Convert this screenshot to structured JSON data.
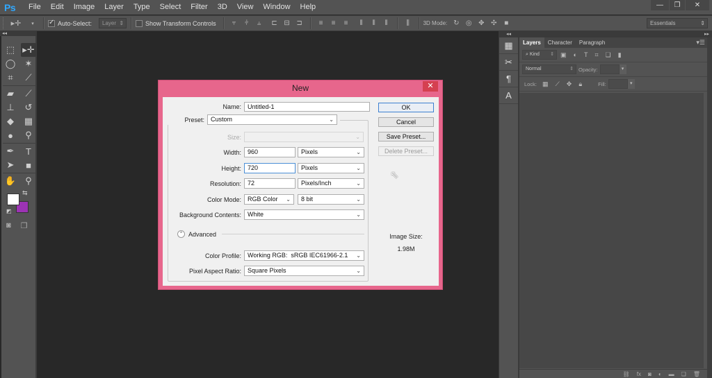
{
  "app": {
    "logo": "Ps",
    "menu": [
      "File",
      "Edit",
      "Image",
      "Layer",
      "Type",
      "Select",
      "Filter",
      "3D",
      "View",
      "Window",
      "Help"
    ],
    "window_controls": {
      "minimize": "—",
      "restore": "❐",
      "close": "✕"
    }
  },
  "options_bar": {
    "auto_select_label": "Auto-Select:",
    "auto_select_checked": true,
    "auto_select_target": "Layer",
    "show_transform_label": "Show Transform Controls",
    "show_transform_checked": false,
    "mode_3d_label": "3D Mode:",
    "workspace": "Essentials"
  },
  "toolbar": {
    "foreground_color": "#ffffff",
    "background_color": "#9c33b4"
  },
  "panels": {
    "tabs": [
      "Layers",
      "Character",
      "Paragraph"
    ],
    "active_tab": "Layers",
    "filter_kind": "Kind",
    "blend_mode": "Normal",
    "opacity_label": "Opacity:",
    "lock_label": "Lock:",
    "fill_label": "Fill:"
  },
  "dialog": {
    "title": "New",
    "close_glyph": "✕",
    "name_label": "Name:",
    "name_value": "Untitled-1",
    "preset_label": "Preset:",
    "preset_value": "Custom",
    "size_label": "Size:",
    "size_value": "",
    "width_label": "Width:",
    "width_value": "960",
    "width_unit": "Pixels",
    "height_label": "Height:",
    "height_value": "720",
    "height_unit": "Pixels",
    "resolution_label": "Resolution:",
    "resolution_value": "72",
    "resolution_unit": "Pixels/Inch",
    "color_mode_label": "Color Mode:",
    "color_mode_value": "RGB Color",
    "bit_depth": "8 bit",
    "background_label": "Background Contents:",
    "background_value": "White",
    "advanced_label": "Advanced",
    "color_profile_label": "Color Profile:",
    "color_profile_value": "Working RGB:  sRGB IEC61966-2.1",
    "pixel_aspect_label": "Pixel Aspect Ratio:",
    "pixel_aspect_value": "Square Pixels",
    "buttons": {
      "ok": "OK",
      "cancel": "Cancel",
      "save_preset": "Save Preset...",
      "delete_preset": "Delete Preset..."
    },
    "image_size_label": "Image Size:",
    "image_size_value": "1.98M"
  }
}
